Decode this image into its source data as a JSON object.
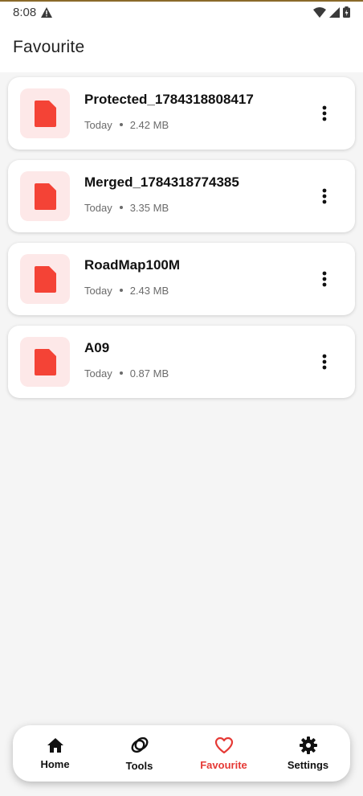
{
  "status_bar": {
    "time": "8:08"
  },
  "header": {
    "title": "Favourite"
  },
  "files": [
    {
      "name": "Protected_1784318808417",
      "date": "Today",
      "size": "2.42 MB"
    },
    {
      "name": "Merged_1784318774385",
      "date": "Today",
      "size": "3.35 MB"
    },
    {
      "name": "RoadMap100M",
      "date": "Today",
      "size": "2.43 MB"
    },
    {
      "name": "A09",
      "date": "Today",
      "size": "0.87 MB"
    }
  ],
  "bottom_nav": {
    "items": [
      {
        "label": "Home",
        "icon": "home-icon"
      },
      {
        "label": "Tools",
        "icon": "tools-icon"
      },
      {
        "label": "Favourite",
        "icon": "heart-icon",
        "active": true
      },
      {
        "label": "Settings",
        "icon": "gear-icon"
      }
    ]
  },
  "colors": {
    "accent": "#e53935",
    "file_icon": "#f44336",
    "thumb_bg": "#fde8e8"
  }
}
